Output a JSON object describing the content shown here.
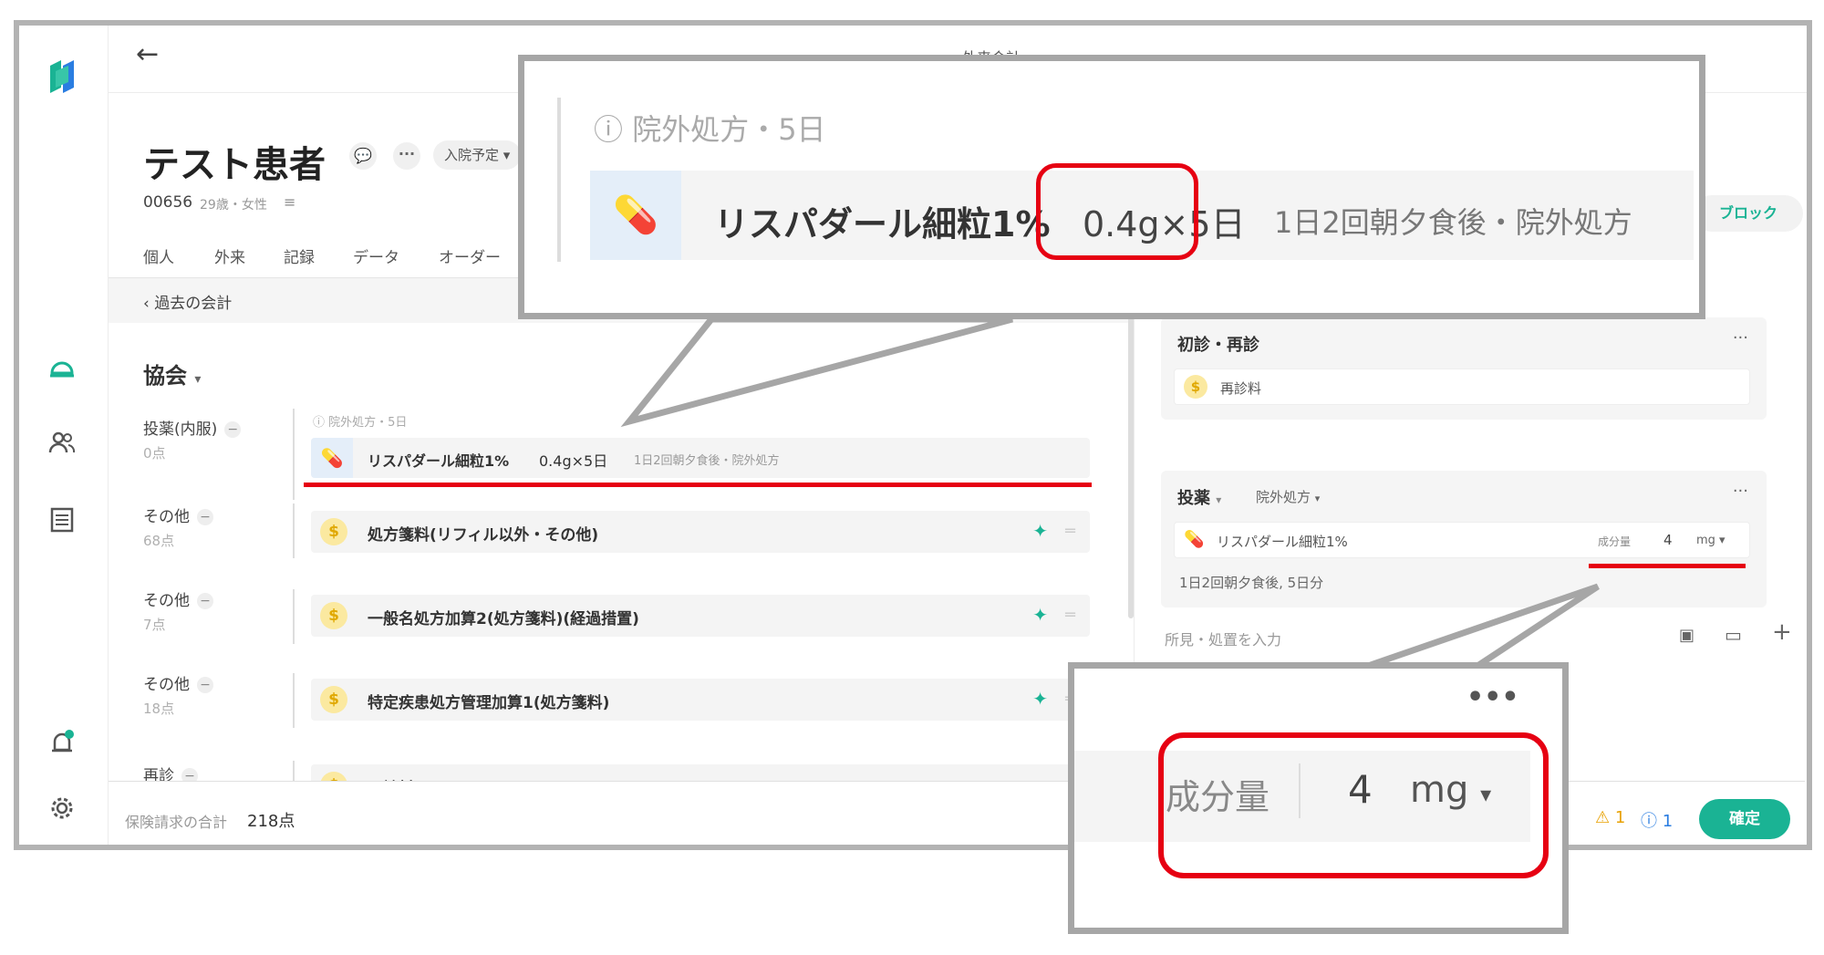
{
  "window_title": "外来会計",
  "patient": {
    "name": "テスト患者",
    "status": "入院予定",
    "id": "00656",
    "age_sex": "29歳・女性"
  },
  "tabs": [
    "個人",
    "外来",
    "記録",
    "データ",
    "オーダー"
  ],
  "past_accounting_link": "過去の会計",
  "insurer": "協会",
  "rows": [
    {
      "label": "投薬(内服)",
      "points": "0点"
    },
    {
      "label": "その他",
      "points": "68点"
    },
    {
      "label": "その他",
      "points": "7点"
    },
    {
      "label": "その他",
      "points": "18点"
    },
    {
      "label": "再診",
      "points": ""
    }
  ],
  "prescription": {
    "header": "院外処方・5日",
    "drug": "リスパダール細粒1%",
    "dose": "0.4g×5日",
    "instructions": "1日2回朝夕食後・院外処方"
  },
  "items": [
    "処方箋料(リフィル以外・その他)",
    "一般名処方加算2(処方箋料)(経過措置)",
    "特定疾患処方管理加算1(処方箋料)",
    "再診料"
  ],
  "footer": {
    "total_label": "保険請求の合計",
    "total_value": "218点",
    "warning_count": "1",
    "info_count": "1",
    "confirm_button": "確定"
  },
  "right_panel": {
    "block_button": "ブロック",
    "first_visit_card_title": "初診・再診",
    "first_visit_item": "再診料",
    "medication_card_title": "投薬",
    "medication_type": "院外処方",
    "drug_name": "リスパダール細粒1%",
    "amount_label": "成分量",
    "amount_value": "4",
    "amount_unit": "mg",
    "dosage_note": "1日2回朝夕食後, 5日分",
    "findings_placeholder": "所見・処置を入力"
  },
  "callout_top": {
    "header": "院外処方・5日",
    "drug": "リスパダール細粒1%",
    "dose": "0.4g×5日",
    "instructions": "1日2回朝夕食後・院外処方"
  },
  "callout_bottom": {
    "amount_label": "成分量",
    "amount_value": "4",
    "amount_unit": "mg"
  },
  "colors": {
    "accent_green": "#1ab394",
    "highlight_red": "#e60012",
    "pill_blue": "#2a7de1"
  }
}
